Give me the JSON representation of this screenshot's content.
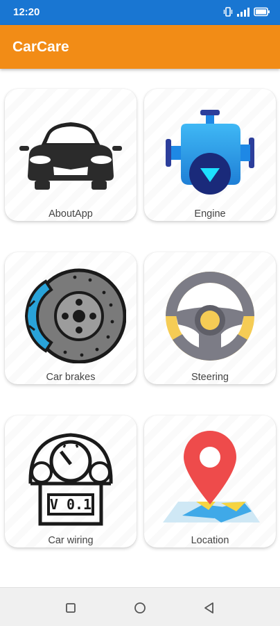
{
  "status_bar": {
    "time": "12:20"
  },
  "app_bar": {
    "title": "CarCare"
  },
  "cards": [
    {
      "label": "AboutApp",
      "icon": "car-front-icon"
    },
    {
      "label": "Engine",
      "icon": "engine-icon"
    },
    {
      "label": "Car brakes",
      "icon": "brake-disc-icon"
    },
    {
      "label": "Steering",
      "icon": "steering-wheel-icon"
    },
    {
      "label": "Car wiring",
      "icon": "dashboard-gauge-icon"
    },
    {
      "label": "Location",
      "icon": "map-pin-icon"
    }
  ],
  "nav_bar": {
    "buttons": [
      "recents-square-icon",
      "home-circle-icon",
      "back-triangle-icon"
    ]
  },
  "colors": {
    "status_bar": "#1976d2",
    "app_bar": "#f28c16"
  }
}
